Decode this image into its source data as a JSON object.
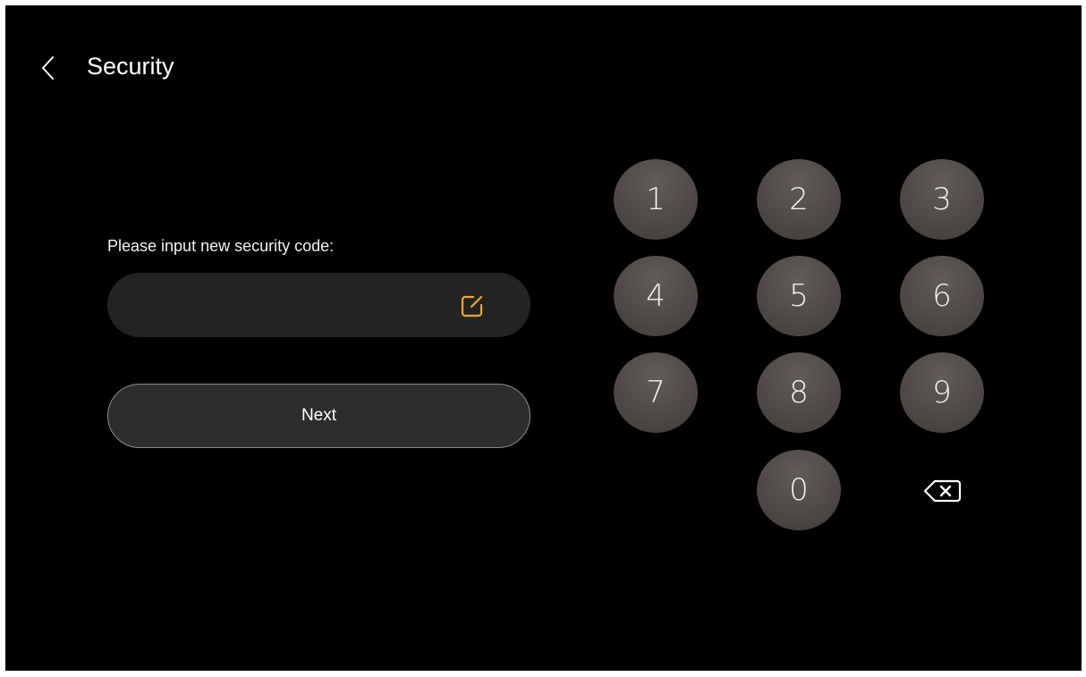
{
  "header": {
    "title": "Security",
    "back_icon": "chevron-left-icon"
  },
  "form": {
    "prompt": "Please input new security code:",
    "code_value": "",
    "edit_icon": "edit-icon",
    "next_label": "Next"
  },
  "keypad": {
    "keys": [
      "1",
      "2",
      "3",
      "4",
      "5",
      "6",
      "7",
      "8",
      "9",
      "0"
    ],
    "backspace_icon": "backspace-icon"
  },
  "colors": {
    "background": "#000000",
    "field_background": "#232323",
    "accent": "#f5a623",
    "key_background": "#4f4947",
    "text": "#ffffff"
  }
}
